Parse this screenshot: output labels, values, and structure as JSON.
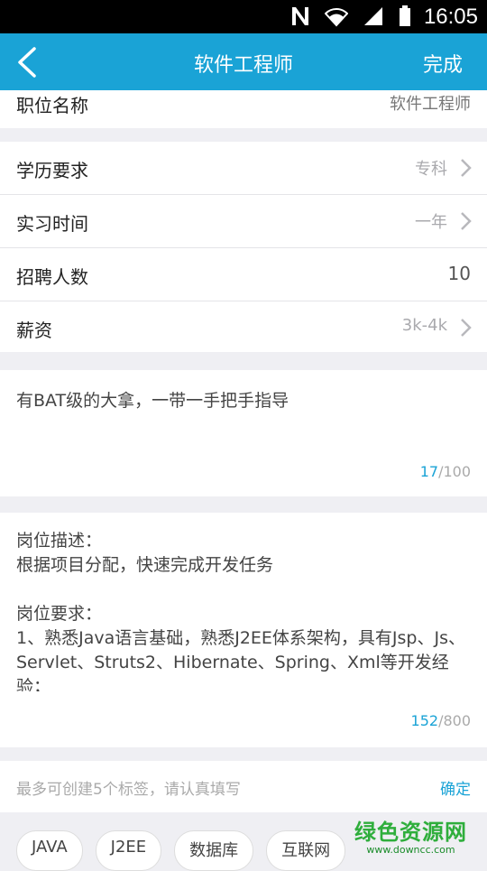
{
  "status_bar": {
    "time": "16:05",
    "icons": [
      "n-icon",
      "wifi-icon",
      "signal-icon",
      "battery-icon"
    ]
  },
  "nav": {
    "title": "软件工程师",
    "done_label": "完成",
    "accent": "#1aa3d6"
  },
  "position": {
    "label": "职位名称",
    "value": "软件工程师"
  },
  "fields": [
    {
      "label": "学历要求",
      "value": "专科"
    },
    {
      "label": "实习时间",
      "value": "一年"
    },
    {
      "label": "招聘人数",
      "value": "10"
    },
    {
      "label": "薪资",
      "value": "3k-4k"
    }
  ],
  "highlight": {
    "text": "有BAT级的大拿，一带一手把手指导",
    "count": "17",
    "max": "/100"
  },
  "description": {
    "text": "岗位描述：\n根据项目分配，快速完成开发任务\n\n岗位要求：\n1、熟悉Java语言基础，熟悉J2EE体系架构，具有Jsp、Js、Servlet、Struts2、Hibernate、Spring、Xml等开发经验；",
    "count": "152",
    "max": "/800"
  },
  "tags_section": {
    "hint": "最多可创建5个标签，请认真填写",
    "confirm_label": "确定",
    "tags": [
      "JAVA",
      "J2EE",
      "数据库",
      "互联网"
    ]
  },
  "watermark": {
    "main": "绿色资源网",
    "sub": "www.downcc.com"
  }
}
